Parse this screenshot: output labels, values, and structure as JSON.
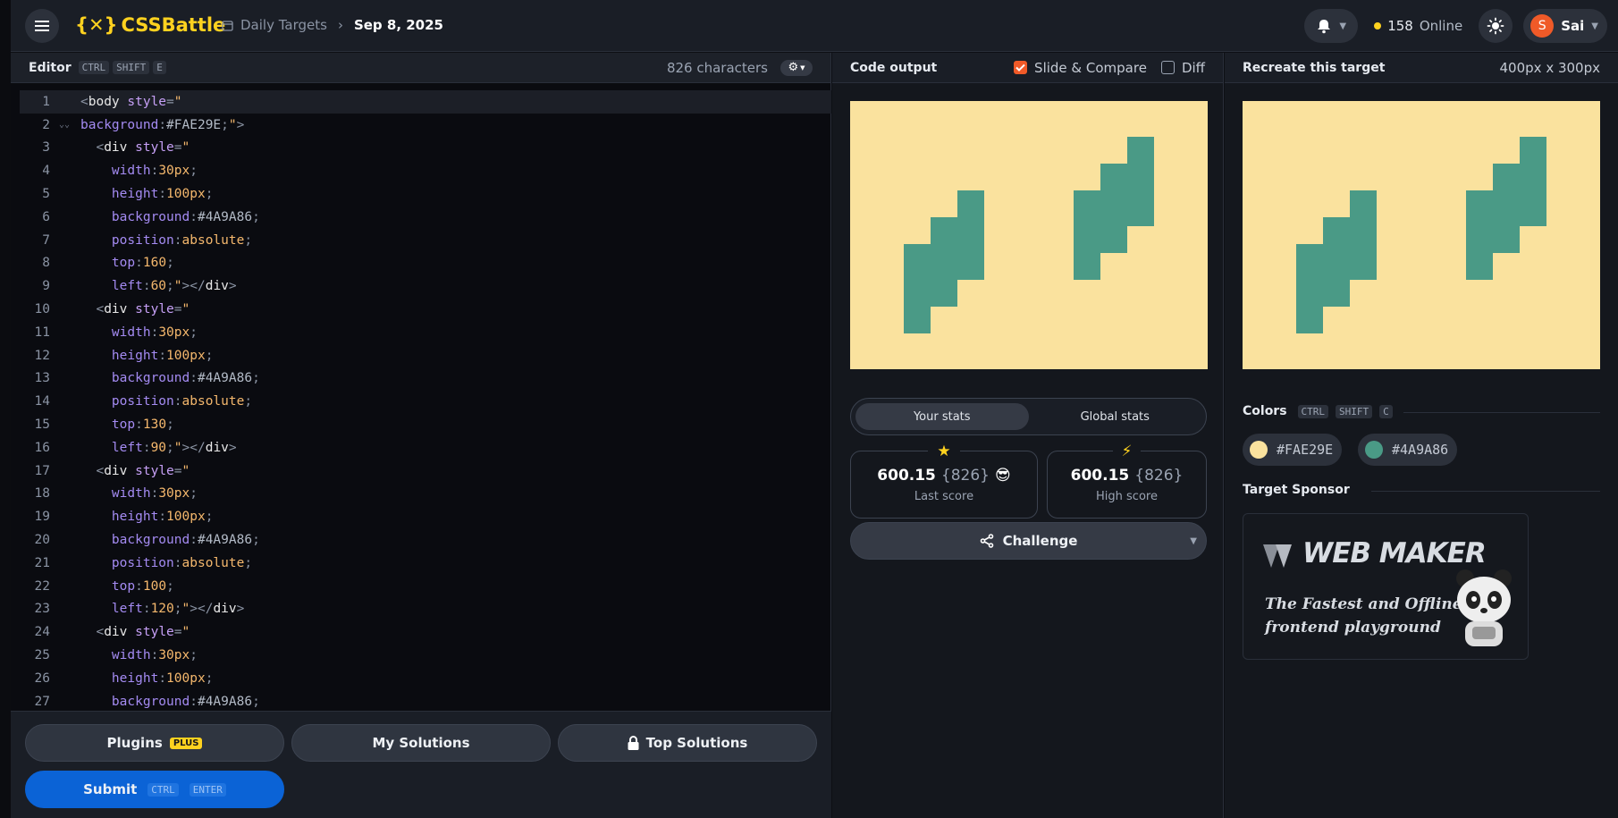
{
  "header": {
    "logo_text": "CSSBattle",
    "breadcrumb_parent": "Daily Targets",
    "breadcrumb_current": "Sep 8, 2025",
    "online_count": "158",
    "online_label": "Online",
    "user_initial": "S",
    "user_name": "Sai"
  },
  "editor": {
    "title": "Editor",
    "shortcut": [
      "CTRL",
      "SHIFT",
      "E"
    ],
    "char_count": "826 characters",
    "lines": [
      [
        [
          "tok-punc",
          "<"
        ],
        [
          "tok-tag",
          "body "
        ],
        [
          "tok-attr",
          "style"
        ],
        [
          "tok-punc",
          "="
        ],
        [
          "tok-str",
          "\""
        ]
      ],
      [
        [
          "tok-prop",
          "background"
        ],
        [
          "tok-punc",
          ":"
        ],
        [
          "tok-hex",
          "#FAE29E"
        ],
        [
          "tok-punc",
          ";"
        ],
        [
          "tok-str",
          "\""
        ],
        [
          "tok-punc",
          ">"
        ]
      ],
      [
        [
          "tok-tag",
          "  "
        ],
        [
          "tok-punc",
          "<"
        ],
        [
          "tok-tag",
          "div "
        ],
        [
          "tok-attr",
          "style"
        ],
        [
          "tok-punc",
          "="
        ],
        [
          "tok-str",
          "\""
        ]
      ],
      [
        [
          "tok-tag",
          "    "
        ],
        [
          "tok-prop",
          "width"
        ],
        [
          "tok-punc",
          ":"
        ],
        [
          "tok-val",
          "30px"
        ],
        [
          "tok-punc",
          ";"
        ]
      ],
      [
        [
          "tok-tag",
          "    "
        ],
        [
          "tok-prop",
          "height"
        ],
        [
          "tok-punc",
          ":"
        ],
        [
          "tok-val",
          "100px"
        ],
        [
          "tok-punc",
          ";"
        ]
      ],
      [
        [
          "tok-tag",
          "    "
        ],
        [
          "tok-prop",
          "background"
        ],
        [
          "tok-punc",
          ":"
        ],
        [
          "tok-hex",
          "#4A9A86"
        ],
        [
          "tok-punc",
          ";"
        ]
      ],
      [
        [
          "tok-tag",
          "    "
        ],
        [
          "tok-prop",
          "position"
        ],
        [
          "tok-punc",
          ":"
        ],
        [
          "tok-val",
          "absolute"
        ],
        [
          "tok-punc",
          ";"
        ]
      ],
      [
        [
          "tok-tag",
          "    "
        ],
        [
          "tok-prop",
          "top"
        ],
        [
          "tok-punc",
          ":"
        ],
        [
          "tok-val",
          "160"
        ],
        [
          "tok-punc",
          ";"
        ]
      ],
      [
        [
          "tok-tag",
          "    "
        ],
        [
          "tok-prop",
          "left"
        ],
        [
          "tok-punc",
          ":"
        ],
        [
          "tok-val",
          "60"
        ],
        [
          "tok-punc",
          ";"
        ],
        [
          "tok-str",
          "\""
        ],
        [
          "tok-punc",
          "></"
        ],
        [
          "tok-tag",
          "div"
        ],
        [
          "tok-punc",
          ">"
        ]
      ],
      [
        [
          "tok-tag",
          "  "
        ],
        [
          "tok-punc",
          "<"
        ],
        [
          "tok-tag",
          "div "
        ],
        [
          "tok-attr",
          "style"
        ],
        [
          "tok-punc",
          "="
        ],
        [
          "tok-str",
          "\""
        ]
      ],
      [
        [
          "tok-tag",
          "    "
        ],
        [
          "tok-prop",
          "width"
        ],
        [
          "tok-punc",
          ":"
        ],
        [
          "tok-val",
          "30px"
        ],
        [
          "tok-punc",
          ";"
        ]
      ],
      [
        [
          "tok-tag",
          "    "
        ],
        [
          "tok-prop",
          "height"
        ],
        [
          "tok-punc",
          ":"
        ],
        [
          "tok-val",
          "100px"
        ],
        [
          "tok-punc",
          ";"
        ]
      ],
      [
        [
          "tok-tag",
          "    "
        ],
        [
          "tok-prop",
          "background"
        ],
        [
          "tok-punc",
          ":"
        ],
        [
          "tok-hex",
          "#4A9A86"
        ],
        [
          "tok-punc",
          ";"
        ]
      ],
      [
        [
          "tok-tag",
          "    "
        ],
        [
          "tok-prop",
          "position"
        ],
        [
          "tok-punc",
          ":"
        ],
        [
          "tok-val",
          "absolute"
        ],
        [
          "tok-punc",
          ";"
        ]
      ],
      [
        [
          "tok-tag",
          "    "
        ],
        [
          "tok-prop",
          "top"
        ],
        [
          "tok-punc",
          ":"
        ],
        [
          "tok-val",
          "130"
        ],
        [
          "tok-punc",
          ";"
        ]
      ],
      [
        [
          "tok-tag",
          "    "
        ],
        [
          "tok-prop",
          "left"
        ],
        [
          "tok-punc",
          ":"
        ],
        [
          "tok-val",
          "90"
        ],
        [
          "tok-punc",
          ";"
        ],
        [
          "tok-str",
          "\""
        ],
        [
          "tok-punc",
          "></"
        ],
        [
          "tok-tag",
          "div"
        ],
        [
          "tok-punc",
          ">"
        ]
      ],
      [
        [
          "tok-tag",
          "  "
        ],
        [
          "tok-punc",
          "<"
        ],
        [
          "tok-tag",
          "div "
        ],
        [
          "tok-attr",
          "style"
        ],
        [
          "tok-punc",
          "="
        ],
        [
          "tok-str",
          "\""
        ]
      ],
      [
        [
          "tok-tag",
          "    "
        ],
        [
          "tok-prop",
          "width"
        ],
        [
          "tok-punc",
          ":"
        ],
        [
          "tok-val",
          "30px"
        ],
        [
          "tok-punc",
          ";"
        ]
      ],
      [
        [
          "tok-tag",
          "    "
        ],
        [
          "tok-prop",
          "height"
        ],
        [
          "tok-punc",
          ":"
        ],
        [
          "tok-val",
          "100px"
        ],
        [
          "tok-punc",
          ";"
        ]
      ],
      [
        [
          "tok-tag",
          "    "
        ],
        [
          "tok-prop",
          "background"
        ],
        [
          "tok-punc",
          ":"
        ],
        [
          "tok-hex",
          "#4A9A86"
        ],
        [
          "tok-punc",
          ";"
        ]
      ],
      [
        [
          "tok-tag",
          "    "
        ],
        [
          "tok-prop",
          "position"
        ],
        [
          "tok-punc",
          ":"
        ],
        [
          "tok-val",
          "absolute"
        ],
        [
          "tok-punc",
          ";"
        ]
      ],
      [
        [
          "tok-tag",
          "    "
        ],
        [
          "tok-prop",
          "top"
        ],
        [
          "tok-punc",
          ":"
        ],
        [
          "tok-val",
          "100"
        ],
        [
          "tok-punc",
          ";"
        ]
      ],
      [
        [
          "tok-tag",
          "    "
        ],
        [
          "tok-prop",
          "left"
        ],
        [
          "tok-punc",
          ":"
        ],
        [
          "tok-val",
          "120"
        ],
        [
          "tok-punc",
          ";"
        ],
        [
          "tok-str",
          "\""
        ],
        [
          "tok-punc",
          "></"
        ],
        [
          "tok-tag",
          "div"
        ],
        [
          "tok-punc",
          ">"
        ]
      ],
      [
        [
          "tok-tag",
          "  "
        ],
        [
          "tok-punc",
          "<"
        ],
        [
          "tok-tag",
          "div "
        ],
        [
          "tok-attr",
          "style"
        ],
        [
          "tok-punc",
          "="
        ],
        [
          "tok-str",
          "\""
        ]
      ],
      [
        [
          "tok-tag",
          "    "
        ],
        [
          "tok-prop",
          "width"
        ],
        [
          "tok-punc",
          ":"
        ],
        [
          "tok-val",
          "30px"
        ],
        [
          "tok-punc",
          ";"
        ]
      ],
      [
        [
          "tok-tag",
          "    "
        ],
        [
          "tok-prop",
          "height"
        ],
        [
          "tok-punc",
          ":"
        ],
        [
          "tok-val",
          "100px"
        ],
        [
          "tok-punc",
          ";"
        ]
      ],
      [
        [
          "tok-tag",
          "    "
        ],
        [
          "tok-prop",
          "background"
        ],
        [
          "tok-punc",
          ":"
        ],
        [
          "tok-hex",
          "#4A9A86"
        ],
        [
          "tok-punc",
          ";"
        ]
      ]
    ],
    "footer": {
      "plugins_label": "Plugins",
      "plugins_badge": "PLUS",
      "my_solutions_label": "My Solutions",
      "top_solutions_label": "Top Solutions",
      "submit_label": "Submit",
      "submit_shortcut": [
        "CTRL",
        "ENTER"
      ]
    }
  },
  "output": {
    "title": "Code output",
    "slide_compare_label": "Slide & Compare",
    "slide_compare_checked": true,
    "diff_label": "Diff",
    "diff_checked": false,
    "stats_tabs": [
      "Your stats",
      "Global stats"
    ],
    "active_stats_tab": 0,
    "last_score": {
      "value": "600.15",
      "chars": "{826}",
      "emoji": "😎",
      "label": "Last score"
    },
    "high_score": {
      "value": "600.15",
      "chars": "{826}",
      "label": "High score"
    },
    "challenge_label": "Challenge"
  },
  "target": {
    "title": "Recreate this target",
    "size": "400px x 300px",
    "colors_title": "Colors",
    "colors_shortcut": [
      "CTRL",
      "SHIFT",
      "C"
    ],
    "colors": [
      {
        "hex": "#FAE29E",
        "label": "#FAE29E"
      },
      {
        "hex": "#4A9A86",
        "label": "#4A9A86"
      }
    ],
    "sponsor_title": "Target Sponsor",
    "sponsor_logo": "WEB MAKER",
    "sponsor_tagline_1": "The Fastest and Offline",
    "sponsor_tagline_2": "frontend playground"
  }
}
